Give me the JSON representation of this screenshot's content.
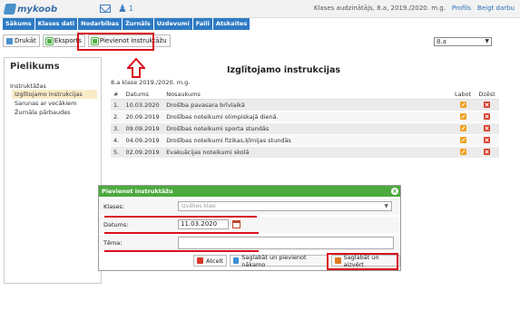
{
  "header": {
    "logo_text": "mykoob",
    "users_count": "1",
    "context": "Klases audzinātājs, 8.a, 2019./2020. m.g.",
    "profile_link": "Profils",
    "logout_link": "Beigt darbu"
  },
  "nav": [
    "Sākums",
    "Klases dati",
    "Nodarbības",
    "Žurnāls",
    "Uzdevumi",
    "Faili",
    "Atskaites"
  ],
  "toolbar": {
    "print": "Drukāt",
    "export": "Eksports",
    "add": "Pievienot instruktāžu",
    "class_selected": "8.a"
  },
  "sidebar": {
    "title": "Pielikums",
    "group": "Instruktāžas",
    "items": [
      "Izglītojamo instrukcijas",
      "Sarunas ar vecākiem",
      "Žurnāla pārbaudes"
    ]
  },
  "main": {
    "title": "Izglītojamo instrukcijas",
    "subtitle": "8.a klase 2019./2020. m.g."
  },
  "table": {
    "headers": [
      "#",
      "Datums",
      "Nosaukums",
      "Labot",
      "Dzēst"
    ],
    "rows": [
      {
        "num": "1.",
        "date": "10.03.2020",
        "title": "Drošība pavasara brīvlaikā"
      },
      {
        "num": "2.",
        "date": "20.09.2019",
        "title": "Drošības noteikumi olimpiskajā dienā."
      },
      {
        "num": "3.",
        "date": "09.09.2019",
        "title": "Drošības noteikumi sporta stundās"
      },
      {
        "num": "4.",
        "date": "04.09.2019",
        "title": "Drošības noteikumi fizikas,ķīmijas stundās"
      },
      {
        "num": "5.",
        "date": "02.09.2019",
        "title": "Evakuācijas noteikumi skolā"
      }
    ]
  },
  "dialog": {
    "title": "Pievienot instruktāžu",
    "class_label": "Klases:",
    "class_placeholder": "Izvēlies klasi",
    "date_label": "Datums:",
    "date_value": "11.03.2020",
    "topic_label": "Tēma:",
    "cancel": "Atcelt",
    "save_add": "Saglabāt un pievienot nākamo",
    "save_close": "Saglabāt un aizvērt"
  },
  "colors": {
    "nav_bg": "#2e7bc4",
    "dialog_header": "#4caa3e",
    "highlight_red": "#d8111c"
  }
}
